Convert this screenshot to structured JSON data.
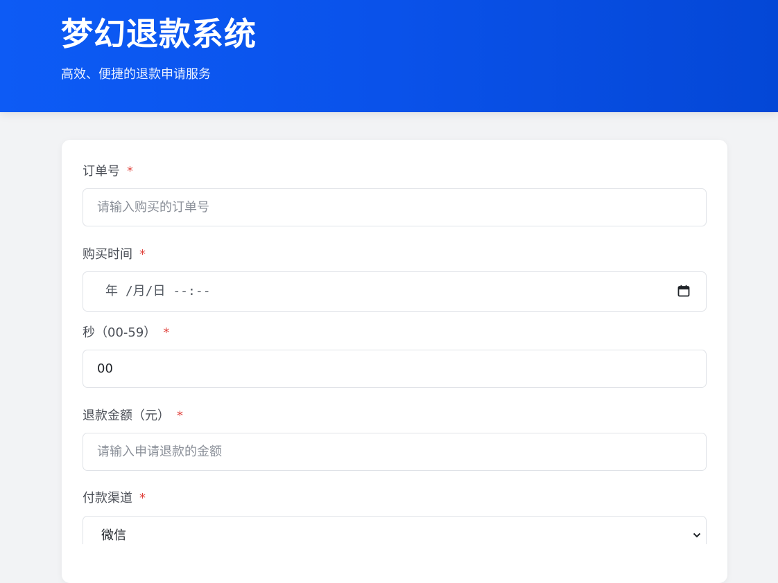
{
  "header": {
    "title": "梦幻退款系统",
    "subtitle": "高效、便捷的退款申请服务"
  },
  "form": {
    "required_mark": "*",
    "order": {
      "label": "订单号",
      "placeholder": "请输入购买的订单号"
    },
    "purchase_time": {
      "label": "购买时间",
      "display": "年 /月/日 --:--",
      "icon": "calendar-icon"
    },
    "seconds": {
      "label": "秒（00-59）",
      "value": "00"
    },
    "amount": {
      "label": "退款金额（元）",
      "placeholder": "请输入申请退款的金额"
    },
    "channel": {
      "label": "付款渠道",
      "selected": "微信",
      "icon": "chevron-down-icon"
    }
  },
  "colors": {
    "header_start": "#0d5bf5",
    "header_end": "#0447d6",
    "required": "#e0443e"
  }
}
